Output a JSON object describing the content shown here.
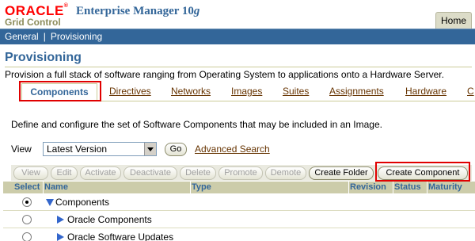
{
  "header": {
    "brand": "ORACLE",
    "product": "Enterprise Manager 10",
    "product_version": "g",
    "subtitle": "Grid Control",
    "home_tab": "Home"
  },
  "nav": {
    "items": [
      "General",
      "Provisioning"
    ],
    "separator": "|"
  },
  "page": {
    "title": "Provisioning",
    "description": "Provision a full stack of software ranging from Operating System to applications onto a Hardware Server."
  },
  "tabs": {
    "active": "Components",
    "items": [
      "Directives",
      "Networks",
      "Images",
      "Suites",
      "Assignments",
      "Hardware",
      "C"
    ]
  },
  "content": {
    "intro": "Define and configure the set of Software Components that may be included in an Image.",
    "view_label": "View",
    "view_value": "Latest Version",
    "go_label": "Go",
    "advanced_search": "Advanced Search"
  },
  "toolbar": {
    "view": "View",
    "edit": "Edit",
    "activate": "Activate",
    "deactivate": "Deactivate",
    "delete": "Delete",
    "promote": "Promote",
    "demote": "Demote",
    "create_folder": "Create Folder",
    "create_component": "Create Component"
  },
  "table": {
    "columns": [
      "Select",
      "Name",
      "Type",
      "Revision",
      "Status",
      "Maturity"
    ],
    "rows": [
      {
        "name": "Components",
        "selected": true,
        "expanded": true
      },
      {
        "name": "Oracle Components",
        "selected": false,
        "expanded": false
      },
      {
        "name": "Oracle Software Updates",
        "selected": false,
        "expanded": false
      }
    ]
  },
  "colors": {
    "brand_red": "#ff0000",
    "nav_blue": "#336699",
    "highlight_red": "#e00000",
    "table_header": "#ccccaa"
  }
}
